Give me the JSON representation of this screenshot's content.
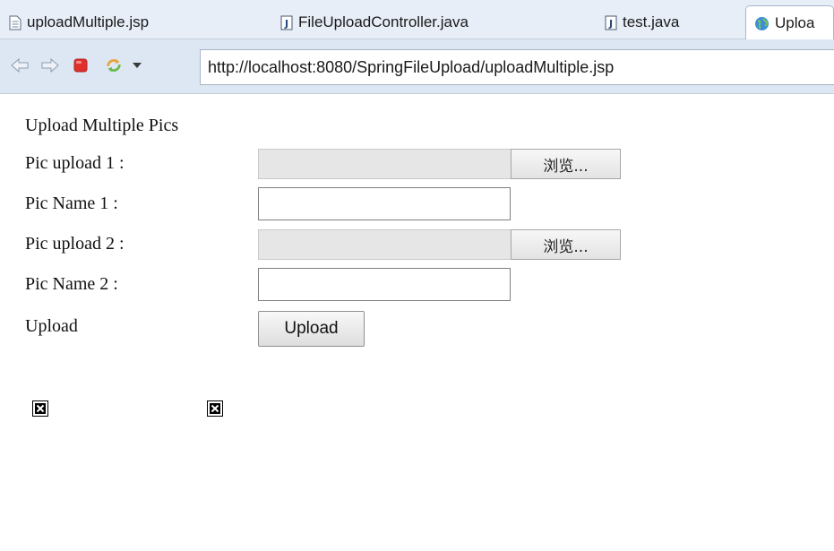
{
  "editor_tabs": [
    {
      "label": "uploadMultiple.jsp",
      "icon": "jsp-file-icon"
    },
    {
      "label": "FileUploadController.java",
      "icon": "java-file-icon"
    },
    {
      "label": "test.java",
      "icon": "java-file-icon"
    },
    {
      "label": "Uploa",
      "icon": "globe-icon",
      "active": true
    }
  ],
  "toolbar": {
    "icons": [
      "back-arrow-icon",
      "forward-arrow-icon",
      "stop-icon",
      "refresh-icon",
      "dropdown-arrow-icon"
    ],
    "url": "http://localhost:8080/SpringFileUpload/uploadMultiple.jsp"
  },
  "page": {
    "heading": "Upload Multiple Pics",
    "rows": {
      "pic_upload_1": {
        "label": "Pic upload 1 :",
        "button": "浏览..."
      },
      "pic_name_1": {
        "label": "Pic Name 1 :",
        "value": ""
      },
      "pic_upload_2": {
        "label": "Pic upload 2 :",
        "button": "浏览..."
      },
      "pic_name_2": {
        "label": "Pic Name 2 :",
        "value": ""
      },
      "upload": {
        "label": "Upload",
        "button": "Upload"
      }
    },
    "broken_images": [
      "broken-image-icon",
      "broken-image-icon"
    ]
  },
  "colors": {
    "tab_strip": "#e7eef8",
    "toolbar": "#dde7f3",
    "stop_red": "#e0302e",
    "file_field": "#e6e6e6"
  }
}
